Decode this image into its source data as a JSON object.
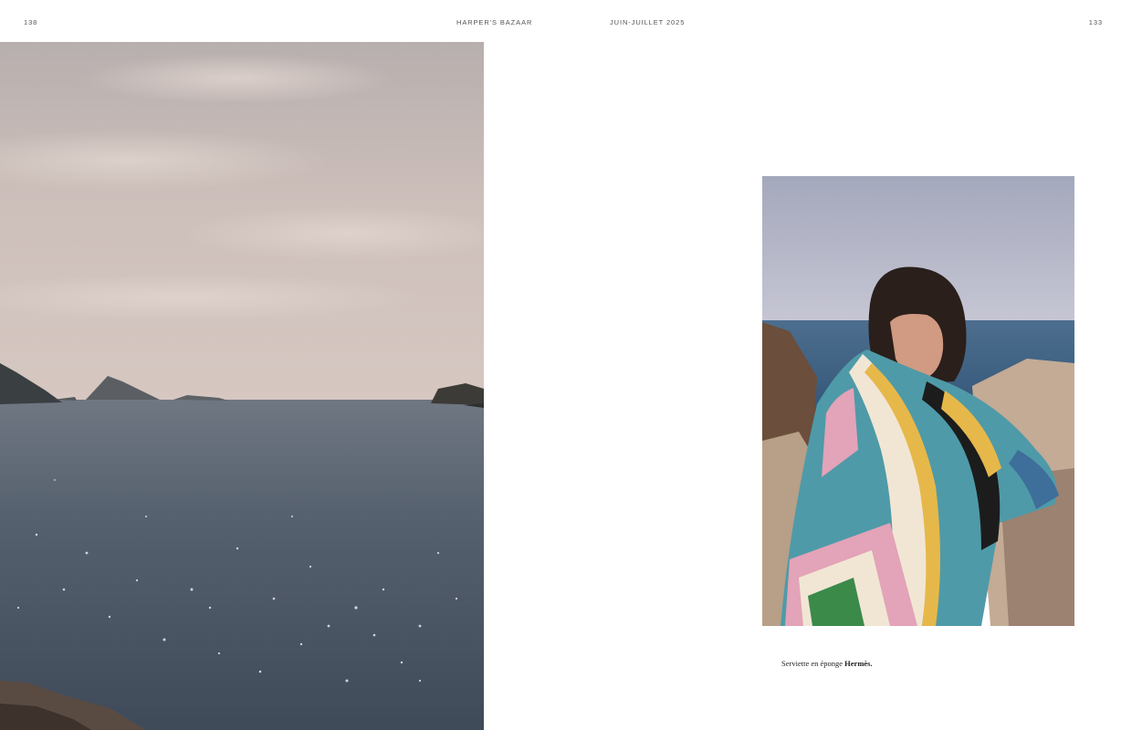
{
  "header": {
    "page_left": "138",
    "masthead": "HARPER'S BAZAAR",
    "issue": "JUIN-JUILLET 2025",
    "page_right": "133"
  },
  "caption": {
    "text": "Serviette en éponge ",
    "brand": "Hermès."
  },
  "colors": {
    "sky": "#c9bdb8",
    "sea": "#4b5866",
    "towel_teal": "#4f9aa8",
    "towel_yellow": "#e6b84a",
    "towel_pink": "#e3a3b8"
  }
}
